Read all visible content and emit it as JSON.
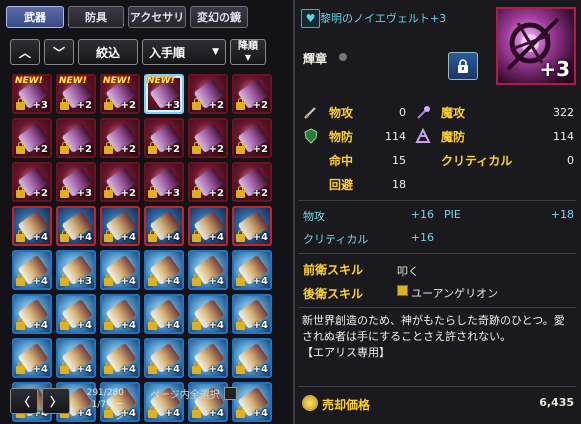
{
  "tabs": [
    {
      "label": "武器",
      "active": true
    },
    {
      "label": "防具",
      "active": false
    },
    {
      "label": "アクセサリ",
      "active": false
    },
    {
      "label": "変幻の鏡",
      "active": false
    }
  ],
  "toolbar": {
    "filter_label": "絞込",
    "sort_label": "入手順",
    "order_label": "降順"
  },
  "grid_cells": [
    {
      "plus": "+3",
      "new": "NEW!",
      "lock": true,
      "rarity": "red"
    },
    {
      "plus": "+2",
      "new": "NEW!",
      "lock": true,
      "rarity": "red"
    },
    {
      "plus": "+2",
      "new": "NEW!",
      "lock": true,
      "rarity": "red"
    },
    {
      "plus": "+3",
      "new": "NEW!",
      "lock": false,
      "rarity": "red",
      "selected": true
    },
    {
      "plus": "+2",
      "new": "",
      "lock": true,
      "rarity": "red"
    },
    {
      "plus": "+2",
      "new": "",
      "lock": true,
      "rarity": "red"
    },
    {
      "plus": "+2",
      "new": "",
      "lock": true,
      "rarity": "red"
    },
    {
      "plus": "+2",
      "new": "",
      "lock": true,
      "rarity": "red"
    },
    {
      "plus": "+2",
      "new": "",
      "lock": true,
      "rarity": "red"
    },
    {
      "plus": "+2",
      "new": "",
      "lock": true,
      "rarity": "red"
    },
    {
      "plus": "+2",
      "new": "",
      "lock": true,
      "rarity": "red"
    },
    {
      "plus": "+2",
      "new": "",
      "lock": true,
      "rarity": "red"
    },
    {
      "plus": "+2",
      "new": "",
      "lock": true,
      "rarity": "red"
    },
    {
      "plus": "+3",
      "new": "",
      "lock": true,
      "rarity": "red"
    },
    {
      "plus": "+2",
      "new": "",
      "lock": true,
      "rarity": "red"
    },
    {
      "plus": "+3",
      "new": "",
      "lock": true,
      "rarity": "red"
    },
    {
      "plus": "+2",
      "new": "",
      "lock": true,
      "rarity": "red"
    },
    {
      "plus": "+2",
      "new": "",
      "lock": true,
      "rarity": "red"
    },
    {
      "plus": "+4",
      "new": "",
      "lock": true,
      "rarity": "red2"
    },
    {
      "plus": "+4",
      "new": "",
      "lock": true,
      "rarity": "red2"
    },
    {
      "plus": "+4",
      "new": "",
      "lock": true,
      "rarity": "red2"
    },
    {
      "plus": "+4",
      "new": "",
      "lock": true,
      "rarity": "red2"
    },
    {
      "plus": "+4",
      "new": "",
      "lock": true,
      "rarity": "red2"
    },
    {
      "plus": "+4",
      "new": "",
      "lock": true,
      "rarity": "red2"
    },
    {
      "plus": "+4",
      "new": "",
      "lock": true,
      "rarity": "blue"
    },
    {
      "plus": "+3",
      "new": "",
      "lock": true,
      "rarity": "blue"
    },
    {
      "plus": "+4",
      "new": "",
      "lock": true,
      "rarity": "blue"
    },
    {
      "plus": "+4",
      "new": "",
      "lock": true,
      "rarity": "blue"
    },
    {
      "plus": "+4",
      "new": "",
      "lock": true,
      "rarity": "blue"
    },
    {
      "plus": "+4",
      "new": "",
      "lock": true,
      "rarity": "blue"
    },
    {
      "plus": "+4",
      "new": "",
      "lock": true,
      "rarity": "blue"
    },
    {
      "plus": "+4",
      "new": "",
      "lock": true,
      "rarity": "blue"
    },
    {
      "plus": "+4",
      "new": "",
      "lock": true,
      "rarity": "blue"
    },
    {
      "plus": "+4",
      "new": "",
      "lock": true,
      "rarity": "blue"
    },
    {
      "plus": "+4",
      "new": "",
      "lock": true,
      "rarity": "blue"
    },
    {
      "plus": "+4",
      "new": "",
      "lock": true,
      "rarity": "blue"
    },
    {
      "plus": "+4",
      "new": "",
      "lock": true,
      "rarity": "blue"
    },
    {
      "plus": "+4",
      "new": "",
      "lock": true,
      "rarity": "blue"
    },
    {
      "plus": "+4",
      "new": "",
      "lock": true,
      "rarity": "blue"
    },
    {
      "plus": "+4",
      "new": "",
      "lock": true,
      "rarity": "blue"
    },
    {
      "plus": "+4",
      "new": "",
      "lock": true,
      "rarity": "blue"
    },
    {
      "plus": "+4",
      "new": "",
      "lock": true,
      "rarity": "blue"
    },
    {
      "plus": "+4",
      "new": "",
      "lock": true,
      "rarity": "blue"
    },
    {
      "plus": "+4",
      "new": "",
      "lock": true,
      "rarity": "blue"
    },
    {
      "plus": "+4",
      "new": "",
      "lock": true,
      "rarity": "blue"
    },
    {
      "plus": "+4",
      "new": "",
      "lock": true,
      "rarity": "blue"
    },
    {
      "plus": "+4",
      "new": "",
      "lock": true,
      "rarity": "blue"
    },
    {
      "plus": "+4",
      "new": "",
      "lock": true,
      "rarity": "blue"
    }
  ],
  "footer": {
    "count": "291/280",
    "page": "1/7ページ",
    "select_all_label": "ページ内全選択"
  },
  "item": {
    "name": "黎明のノイエヴェルト+3",
    "big_plus": "+3",
    "badge": "輝章"
  },
  "stats": {
    "patk_label": "物攻",
    "patk": "0",
    "matk_label": "魔攻",
    "matk": "322",
    "pdef_label": "物防",
    "pdef": "114",
    "mdef_label": "魔防",
    "mdef": "114",
    "hit_label": "命中",
    "hit": "15",
    "crit_label": "クリティカル",
    "crit": "0",
    "eva_label": "回避",
    "eva": "18"
  },
  "bonus": {
    "patk_label": "物攻",
    "patk": "+16",
    "pie_label": "PIE",
    "pie": "+18",
    "crit_label": "クリティカル",
    "crit": "+16"
  },
  "skills": {
    "front_label": "前衛スキル",
    "front": "叩く",
    "back_label": "後衛スキル",
    "back": "ユーアンゲリオン"
  },
  "description": {
    "line1": "新世界創造のため、神がもたらした奇跡のひとつ。愛されぬ者は手にすることさえ許されない。",
    "line2": "【エアリス専用】"
  },
  "sell": {
    "label": "売却価格",
    "value": "6,435"
  }
}
